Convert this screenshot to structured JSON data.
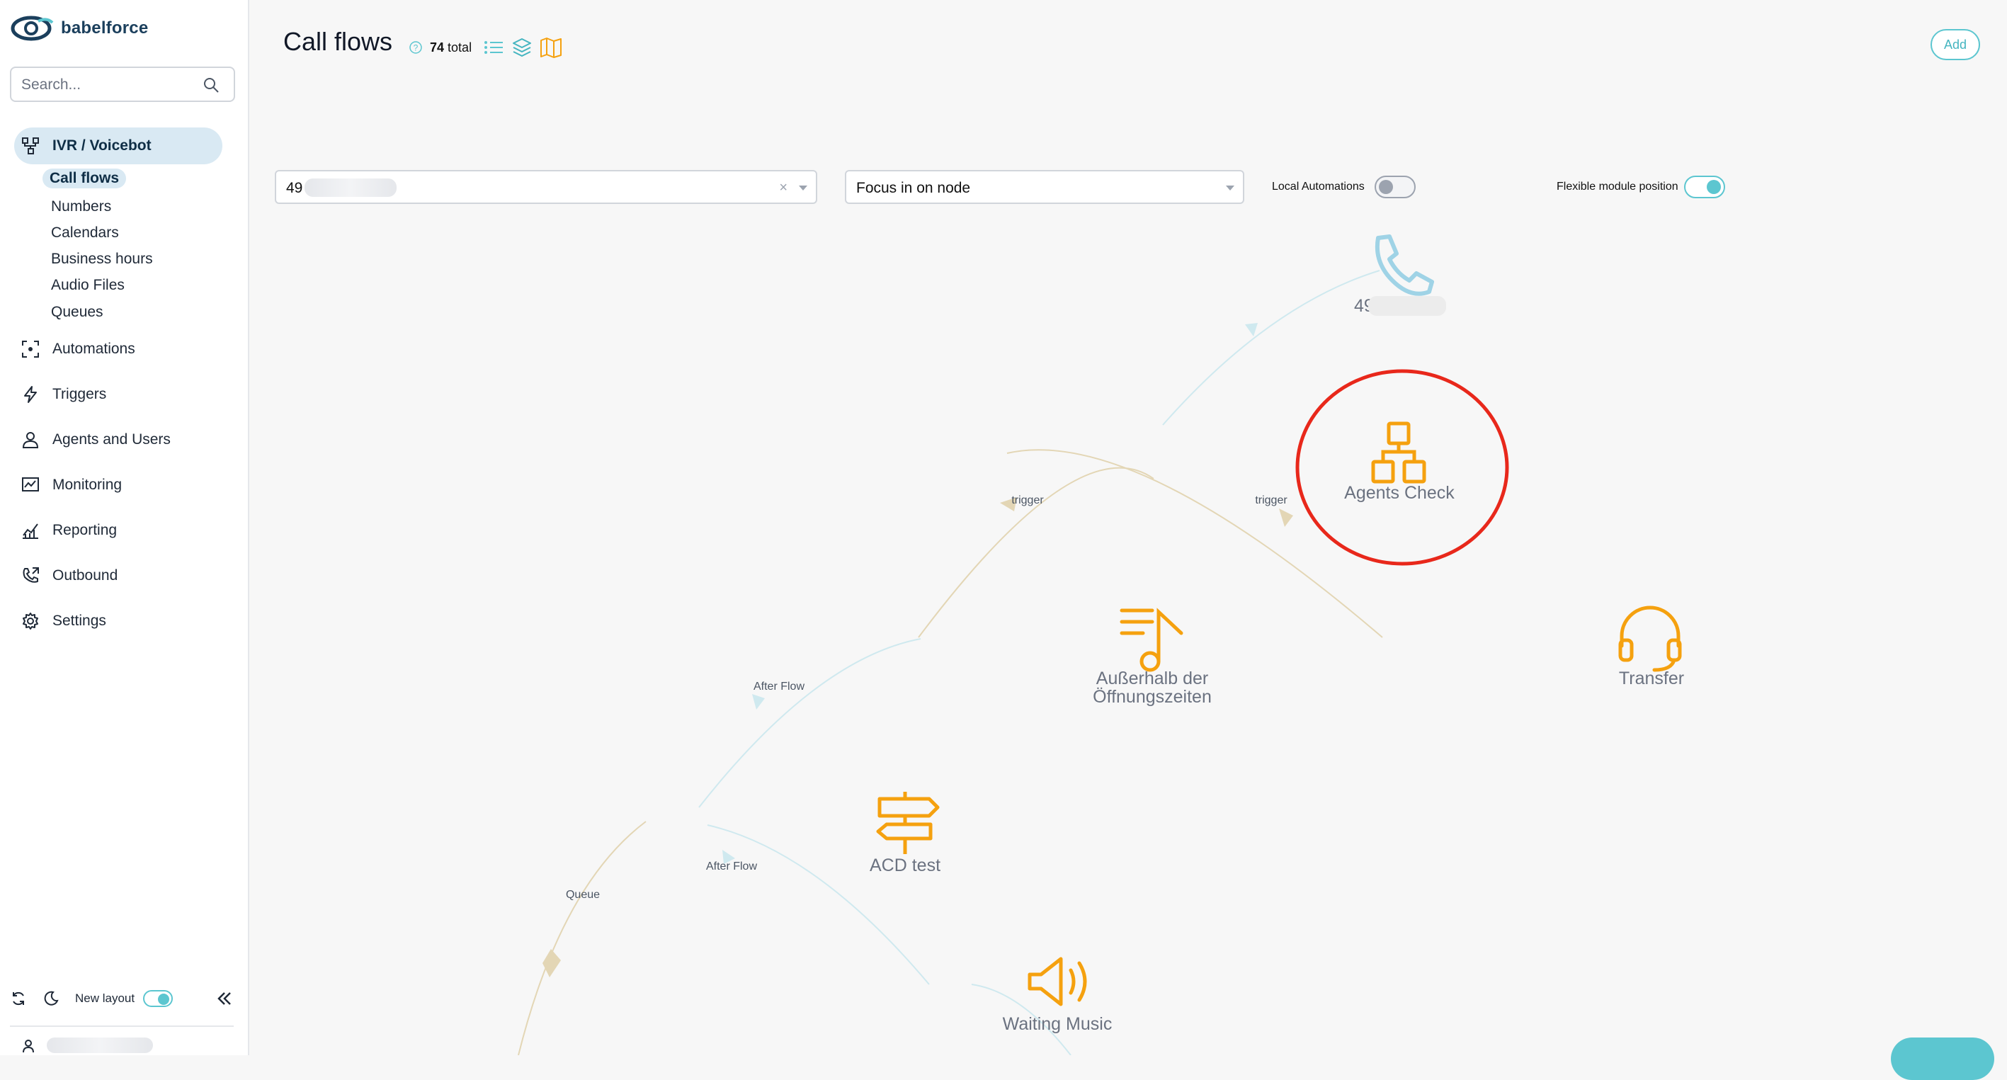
{
  "brand": {
    "name": "babelforce"
  },
  "search": {
    "placeholder": "Search..."
  },
  "sidebar": {
    "ivr_label": "IVR / Voicebot",
    "sub_items": [
      "Call flows",
      "Numbers",
      "Calendars",
      "Business hours",
      "Audio Files",
      "Queues"
    ],
    "items": [
      "Automations",
      "Triggers",
      "Agents and Users",
      "Monitoring",
      "Reporting",
      "Outbound",
      "Settings"
    ],
    "new_layout_label": "New layout",
    "new_layout_enabled": true
  },
  "header": {
    "title": "Call flows",
    "total_number": "74",
    "total_word": "total",
    "add_label": "Add"
  },
  "controls": {
    "flow_select_value": "49",
    "focus_select_value": "Focus in on node",
    "local_automations_label": "Local Automations",
    "local_automations_enabled": false,
    "flexible_position_label": "Flexible module position",
    "flexible_position_enabled": true
  },
  "graph": {
    "nodes": {
      "phone": "49",
      "agents_check": "Agents Check",
      "outside_hours_line1": "Außerhalb der",
      "outside_hours_line2": "Öffnungszeiten",
      "transfer": "Transfer",
      "acd_test": "ACD test",
      "waiting_music": "Waiting Music"
    },
    "edges": {
      "trigger_left": "trigger",
      "trigger_right": "trigger",
      "after_flow_1": "After Flow",
      "after_flow_2": "After Flow",
      "queue": "Queue"
    }
  },
  "colors": {
    "accent": "#5cc6d0",
    "node_icon": "#f5a10f",
    "phone_icon": "#9fd3e6",
    "highlight_circle": "#e8281b",
    "sidebar_active": "#d9e9f3"
  }
}
